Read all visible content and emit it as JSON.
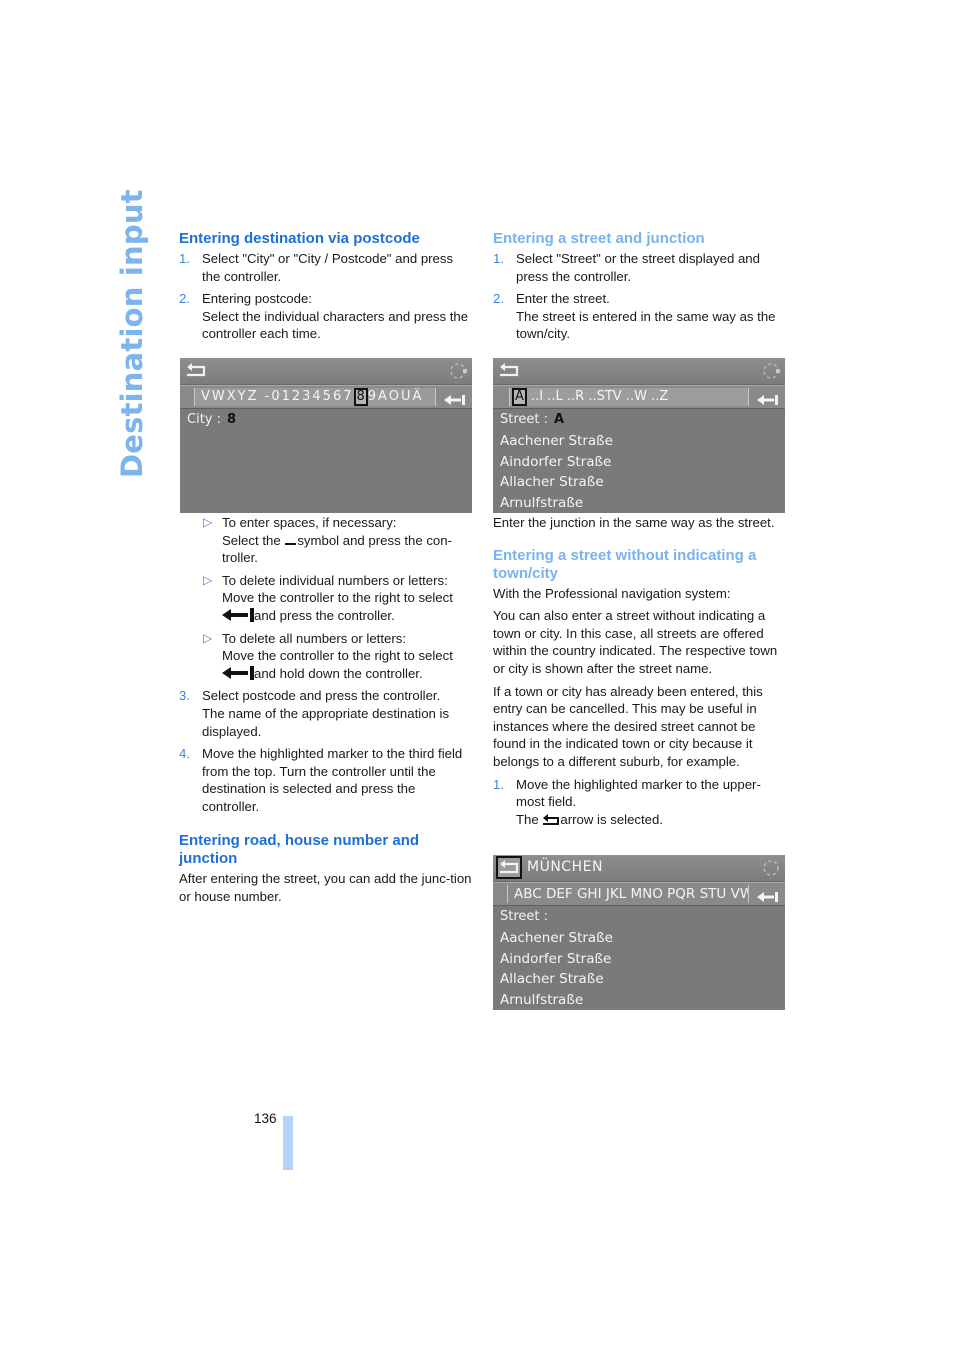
{
  "section_title": "Destination input",
  "page_number": "136",
  "left_column": {
    "heading1": "Entering destination via postcode",
    "steps_a": [
      {
        "num": "1.",
        "text": "Select \"City\" or \"City / Postcode\" and press the controller."
      },
      {
        "num": "2.",
        "line1": "Entering postcode:",
        "line2": "Select the individual characters and press the controller each time."
      }
    ],
    "bullets": [
      {
        "line1": "To enter spaces, if necessary:",
        "pre": "Select the",
        "post": "symbol and press the con-troller."
      },
      {
        "line1": "To delete individual numbers or letters:",
        "line2": "Move the controller to the right to select",
        "post": "and press the controller."
      },
      {
        "line1": "To delete all numbers or letters:",
        "line2": "Move the controller to the right to select",
        "post": "and hold down the controller."
      }
    ],
    "steps_b": [
      {
        "num": "3.",
        "line1": "Select postcode and press the controller.",
        "line2": "The name of the appropriate destination is displayed."
      },
      {
        "num": "4.",
        "text": "Move the highlighted marker to the third field from the top. Turn the controller until the destination is selected and press the controller."
      }
    ],
    "heading2": "Entering road, house number and junction",
    "para": "After entering the street, you can add the junc-tion or house number."
  },
  "right_column": {
    "heading1": "Entering a street and junction",
    "steps_a": [
      {
        "num": "1.",
        "text": "Select \"Street\" or the street displayed and press the controller."
      },
      {
        "num": "2.",
        "line1": "Enter the street.",
        "line2": "The street is entered in the same way as the town/city."
      }
    ],
    "junction_para": "Enter the junction in the same way as the street.",
    "heading2": "Entering a street without indicating a town/city",
    "para1": "With the Professional navigation system:",
    "para2": "You can also enter a street without indicating a town or city. In this case, all streets are offered within the country indicated. The respective town or city is shown after the street name.",
    "para3": "If a town or city has already been entered, this entry can be cancelled. This may be useful in instances where the desired street cannot be found in the indicated town or city because it belongs to a different suburb, for example.",
    "step_b": {
      "num": "1.",
      "line1": "Move the highlighted marker to the upper-most field.",
      "pre": "The",
      "post": "arrow is selected."
    }
  },
  "screens": {
    "postcode": {
      "chars_before": "VWXYZ -01234567",
      "chars_selected": "8",
      "chars_after": "9AOUÄ",
      "field_label": "City :",
      "field_value": "8"
    },
    "street": {
      "chars_selected": "A",
      "chars_after": " ..I ..L ..R ..STV ..W ..Z",
      "field_label": "Street :",
      "field_value": "A",
      "items": [
        "Aachener Straße",
        "Aindorfer Straße",
        "Allacher Straße",
        "Arnulfstraße"
      ]
    },
    "munich": {
      "title": "MÜNCHEN",
      "chars": "ABC DEF GHI JKL MNO PQR STU VW",
      "field_label": "Street :",
      "items": [
        "Aachener Straße",
        "Aindorfer Straße",
        "Allacher Straße",
        "Arnulfstraße"
      ]
    }
  },
  "colors": {
    "heading_blue": "#1e6fd9",
    "heading_light_blue": "#79b2f0",
    "accent_blue": "#3a86de",
    "screen_gray": "#7a7a7a",
    "page_tab": "#b4d3f8"
  }
}
